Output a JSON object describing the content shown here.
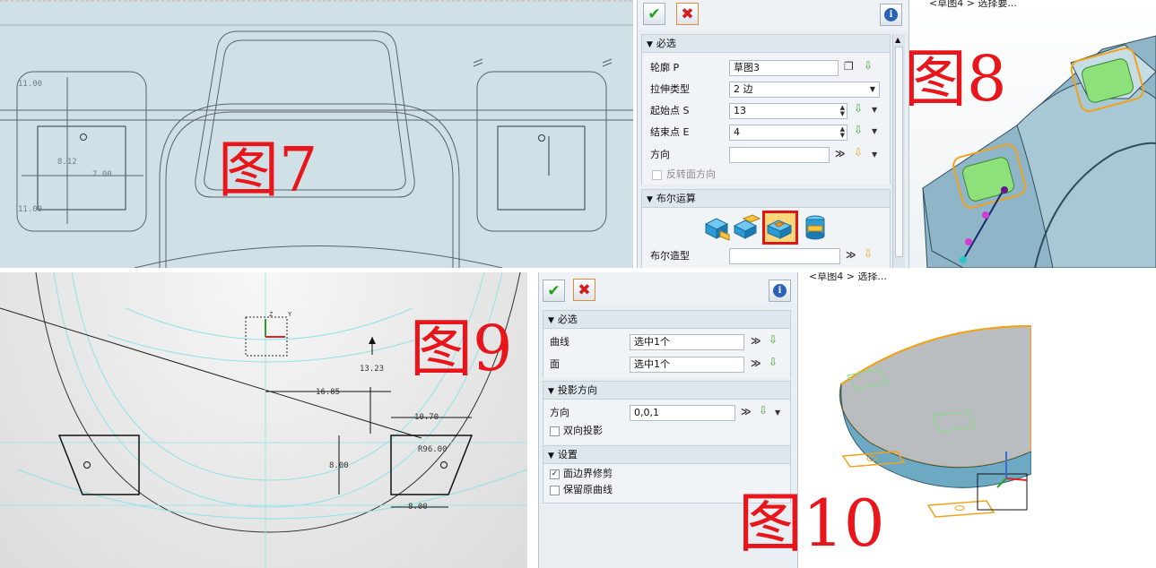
{
  "fig7": {
    "label": "图7",
    "dims": {
      "d1": "11.00",
      "d2": "8.12",
      "d3": "7.00",
      "d4": "11.00"
    }
  },
  "fig8": {
    "label": "图8",
    "header_fragment": "<草图4 > 选择要..."
  },
  "fig9": {
    "label": "图9",
    "dims": {
      "d1": "13.23",
      "d2": "16.85",
      "d3": "10.70",
      "d4": "R96.00",
      "d5": "8.00",
      "d6": "8.00"
    },
    "axis": {
      "z": "Z",
      "y": "Y"
    }
  },
  "fig10": {
    "label": "图10",
    "header_fragment": "<草图4 > 选择..."
  },
  "extrude_dialog": {
    "ok_icon": "check-icon",
    "cancel_icon": "x-icon",
    "info_icon": "info-icon",
    "section_required": "必选",
    "profile_label": "轮廓 P",
    "profile_value": "草图3",
    "extrude_type_label": "拉伸类型",
    "extrude_type_value": "2 边",
    "start_label": "起始点 S",
    "start_value": "13",
    "end_label": "结束点 E",
    "end_value": "4",
    "direction_label": "方向",
    "direction_value": "",
    "flip_label": "反转面方向",
    "section_boolean": "布尔运算",
    "boolean_shape_label": "布尔造型",
    "boolean_shape_value": "",
    "boolean_icons": [
      "base-icon",
      "add-icon",
      "subtract-icon",
      "intersect-icon"
    ],
    "boolean_selected": 2
  },
  "project_dialog": {
    "section_required": "必选",
    "curve_label": "曲线",
    "curve_value": "选中1个",
    "face_label": "面",
    "face_value": "选中1个",
    "section_projection": "投影方向",
    "direction_label": "方向",
    "direction_value": "0,0,1",
    "bidirectional_label": "双向投影",
    "bidirectional_checked": false,
    "section_settings": "设置",
    "trim_label": "面边界修剪",
    "trim_checked": true,
    "keep_label": "保留原曲线",
    "keep_checked": false
  },
  "colors": {
    "label_red": "#e8151b",
    "ok_green": "#22a11a",
    "cancel_red": "#d41a1a",
    "highlight_orange": "#f0a21c"
  }
}
